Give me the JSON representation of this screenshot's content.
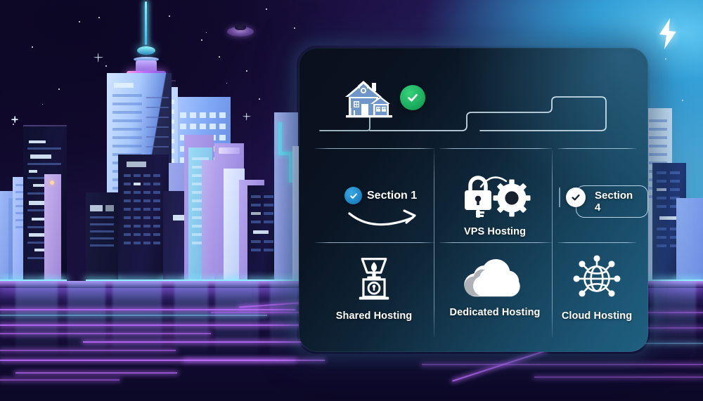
{
  "scene": {
    "title": "Web Hosting Types Infographic",
    "background_style": "neon-cyberpunk-city-night",
    "colors": {
      "sky_dark": "#100a2e",
      "sky_light": "#55c0e8",
      "neon_purple": "#c06bff",
      "neon_cyan": "#8ff0ff",
      "card_dark": "#090f1d",
      "card_teal": "#1e5f80",
      "check_green": "#16a85a",
      "badge_blue": "#1b82c4",
      "text_white": "#ffffff"
    }
  },
  "decor": {
    "lightning_bolt": "lightning-bolt-icon",
    "ufo": "ufo-icon",
    "spire_tower": "spire-tower"
  },
  "card": {
    "top_row": {
      "house_icon": "house-icon",
      "status_icon": "green-check-icon",
      "circuit_path": "circuit-trace-path"
    },
    "cells": [
      {
        "id": "section-1",
        "icon": "blue-check-badge-icon",
        "label": "Section 1",
        "arrow": "curved-arrow-right-icon"
      },
      {
        "id": "vps-hosting",
        "icon": "padlock-gear-icon",
        "label": "VPS Hosting"
      },
      {
        "id": "section-4",
        "icon": "white-check-badge-icon",
        "label": "Section 4"
      },
      {
        "id": "shared-hosting",
        "icon": "trophy-pedestal-icon",
        "label": "Shared Hosting"
      },
      {
        "id": "dedicated-hosting",
        "icon": "cloud-icon",
        "label": "Dedicated Hosting"
      },
      {
        "id": "cloud-hosting",
        "icon": "globe-network-icon",
        "label": "Cloud Hosting"
      }
    ]
  }
}
